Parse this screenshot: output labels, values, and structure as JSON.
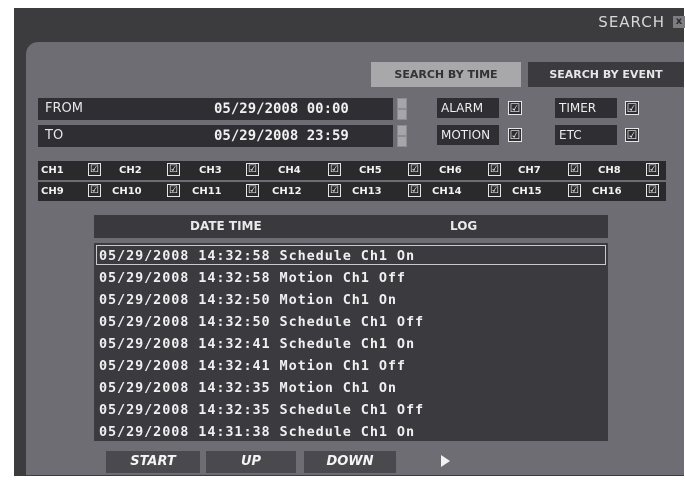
{
  "window": {
    "title": "SEARCH",
    "close_glyph": "x"
  },
  "tabs": [
    {
      "label": "SEARCH BY TIME",
      "active": true
    },
    {
      "label": "SEARCH BY EVENT",
      "active": false
    }
  ],
  "range": {
    "from_label": "FROM",
    "from_value": "05/29/2008 00:00",
    "to_label": "TO",
    "to_value": "05/29/2008 23:59"
  },
  "filters": [
    {
      "label": "ALARM",
      "checked": true
    },
    {
      "label": "TIMER",
      "checked": true
    },
    {
      "label": "MOTION",
      "checked": true
    },
    {
      "label": "ETC",
      "checked": true
    }
  ],
  "channels": [
    "CH1",
    "CH2",
    "CH3",
    "CH4",
    "CH5",
    "CH6",
    "CH7",
    "CH8",
    "CH9",
    "CH10",
    "CH11",
    "CH12",
    "CH13",
    "CH14",
    "CH15",
    "CH16"
  ],
  "check_glyph": "☑",
  "log": {
    "col_datetime": "DATE TIME",
    "col_log": "LOG",
    "rows": [
      "05/29/2008 14:32:58 Schedule Ch1 On",
      "05/29/2008 14:32:58 Motion Ch1 Off",
      "05/29/2008 14:32:50 Motion Ch1 On",
      "05/29/2008 14:32:50 Schedule Ch1 Off",
      "05/29/2008 14:32:41 Schedule Ch1 On",
      "05/29/2008 14:32:41 Motion Ch1 Off",
      "05/29/2008 14:32:35 Motion Ch1 On",
      "05/29/2008 14:32:35 Schedule Ch1 Off",
      "05/29/2008 14:31:38 Schedule Ch1 On"
    ],
    "selected_index": 0
  },
  "buttons": {
    "start": "START",
    "up": "UP",
    "down": "DOWN"
  },
  "icons": {
    "close": "close-icon",
    "cursor": "mouse-cursor-icon",
    "spinner": "spinner-arrows-icon"
  }
}
